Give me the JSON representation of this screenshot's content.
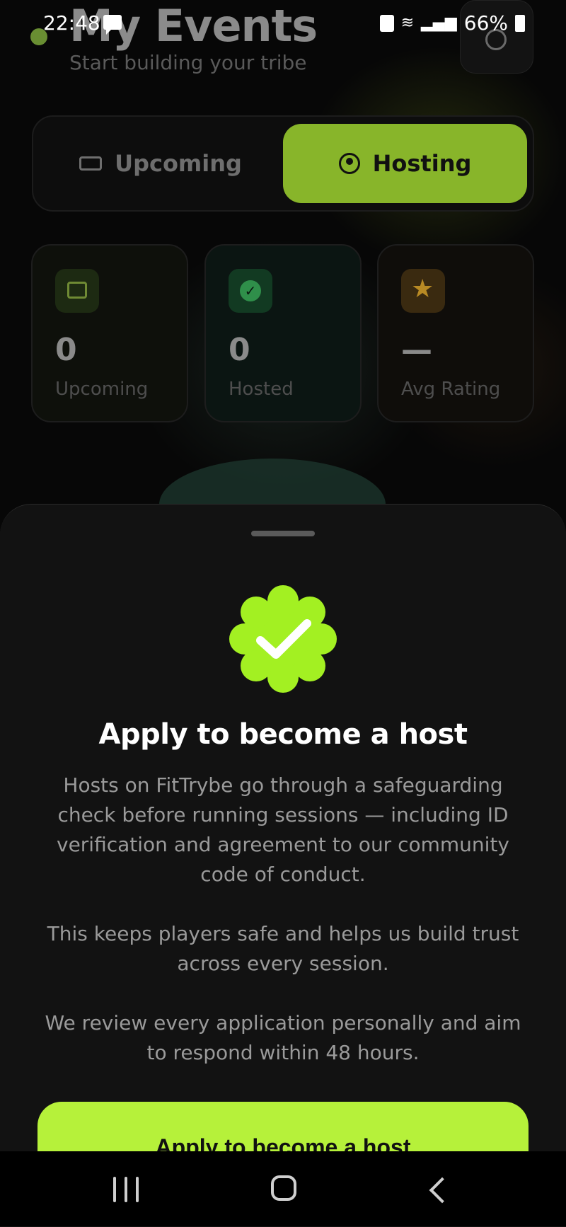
{
  "status_bar": {
    "time": "22:48",
    "battery": "66%"
  },
  "header": {
    "title": "My Events",
    "subtitle": "Start building your tribe"
  },
  "tabs": [
    {
      "label": "Upcoming",
      "icon": "ticket-icon",
      "active": false
    },
    {
      "label": "Hosting",
      "icon": "person-circle-icon",
      "active": true
    }
  ],
  "stats": [
    {
      "value": "0",
      "label": "Upcoming",
      "icon": "calendar-icon"
    },
    {
      "value": "0",
      "label": "Hosted",
      "icon": "check-circle-icon"
    },
    {
      "value": "—",
      "label": "Avg Rating",
      "icon": "star-icon"
    }
  ],
  "sheet": {
    "title": "Apply to become a host",
    "paragraphs": [
      "Hosts on FitTrybe go through a safeguarding check before running sessions — including ID verification and agreement to our community code of conduct.",
      "This keeps players safe and helps us build trust across every session.",
      "We review every application personally and aim to respond within 48 hours."
    ],
    "button_label": "Apply to become a host"
  },
  "colors": {
    "accent": "#b6f13a",
    "hosting_tab": "#88b52a",
    "sheet_bg": "#121212"
  }
}
